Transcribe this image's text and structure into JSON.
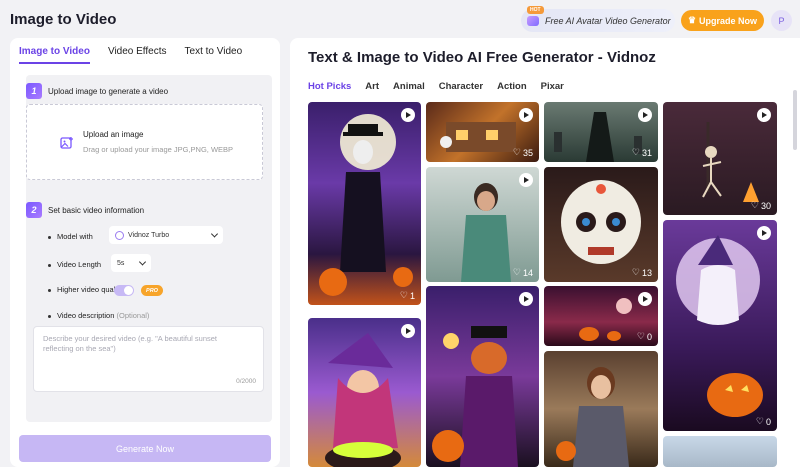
{
  "app": {
    "title": "Image to Video"
  },
  "header": {
    "promo_badge": "HOT",
    "promo_text": "Free AI Avatar Video Generator",
    "upgrade_label": "Upgrade Now",
    "avatar_letter": "P"
  },
  "left": {
    "tabs": [
      {
        "label": "Image to Video",
        "active": true
      },
      {
        "label": "Video Effects",
        "active": false
      },
      {
        "label": "Text to Video",
        "active": false
      }
    ],
    "step1": {
      "num": "1",
      "title": "Upload image to generate a video",
      "upload_title": "Upload an image",
      "upload_sub": "Drag or upload your image JPG,PNG, WEBP"
    },
    "step2": {
      "num": "2",
      "title": "Set basic video information"
    },
    "model_label": "Model with",
    "model_value": "Vidnoz Turbo",
    "length_label": "Video Length",
    "length_value": "5s",
    "quality_label": "Higher video quality",
    "pro_badge": "PRO",
    "desc_label": "Video description",
    "desc_optional": "(Optional)",
    "desc_placeholder": "Describe your desired video (e.g. \"A beautiful sunset reflecting on the sea\")",
    "desc_count": "0/2000",
    "generate_label": "Generate Now"
  },
  "right": {
    "title": "Text & Image to Video AI Free Generator - Vidnoz",
    "categories": [
      {
        "label": "Hot Picks",
        "active": true
      },
      {
        "label": "Art",
        "active": false
      },
      {
        "label": "Animal",
        "active": false
      },
      {
        "label": "Character",
        "active": false
      },
      {
        "label": "Action",
        "active": false
      },
      {
        "label": "Pixar",
        "active": false
      }
    ],
    "cards": [
      {
        "likes": "1"
      },
      {
        "likes": "35"
      },
      {
        "likes": "31"
      },
      {
        "likes": "30"
      },
      {
        "likes": "14"
      },
      {
        "likes": "13"
      },
      {
        "likes": "0"
      },
      {
        "likes": "0"
      }
    ]
  }
}
